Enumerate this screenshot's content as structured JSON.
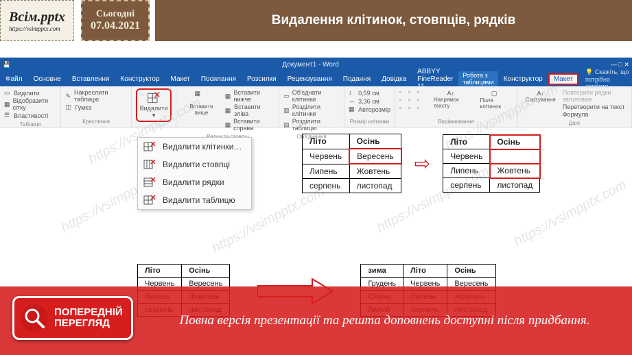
{
  "header": {
    "logo_line1": "Всім.pptx",
    "logo_line2": "https://vsimpptx.com",
    "date_label": "Сьогодні",
    "date_value": "07.04.2021",
    "slide_title": "Видалення клітинок, стовпців, рядків"
  },
  "ribbon": {
    "doc_title": "Документ1 - Word",
    "context_label": "Робота з таблицями",
    "tabs": [
      "Файл",
      "Основне",
      "Вставлення",
      "Конструктор",
      "Макет",
      "Посилання",
      "Розсилки",
      "Рецензування",
      "Подання",
      "Довідка",
      "ABBYY FineReader 11",
      "Конструктор",
      "Макет"
    ],
    "active_tab_index": 12,
    "tell_me": "Скажіть, що потрібно зробити",
    "groups": {
      "table": {
        "label": "Таблиця",
        "items": [
          "Виділити",
          "Відобразити сітку",
          "Властивості"
        ]
      },
      "draw": {
        "label": "Креслення",
        "items": [
          "Накреслити таблицю",
          "Гумка"
        ]
      },
      "delete": {
        "label": "Видалити"
      },
      "rowscols": {
        "label": "Рядки та стовпці",
        "insert_above": "Вставити вище",
        "items": [
          "Вставити нижче",
          "Вставити зліва",
          "Вставити справа"
        ]
      },
      "merge": {
        "label": "Об'єднання",
        "items": [
          "Об'єднати клітинки",
          "Розділити клітинки",
          "Розділити таблицю"
        ]
      },
      "cellsize": {
        "label": "Розмір клітинки",
        "h": "0,59 см",
        "w": "3,36 см",
        "auto": "Авторозмір"
      },
      "align": {
        "label": "Вирівнювання",
        "dir": "Напрямок тексту",
        "margins": "Поля клітинок"
      },
      "data": {
        "label": "Дані",
        "sort": "Сортування",
        "repeat": "Повторити рядки заголовків",
        "convert": "Перетворити на текст",
        "formula": "Формула"
      }
    }
  },
  "dropdown": {
    "items": [
      "Видалити клітинки…",
      "Видалити стовпці",
      "Видалити рядки",
      "Видалити таблицю"
    ]
  },
  "table_before": {
    "headers": [
      "Літо",
      "Осінь"
    ],
    "rows": [
      [
        "Червень",
        "Вересень"
      ],
      [
        "Липень",
        "Жовтень"
      ],
      [
        "серпень",
        "листопад"
      ]
    ]
  },
  "table_after_cell": {
    "headers": [
      "Літо",
      "Осінь"
    ],
    "rows": [
      [
        "Червень",
        ""
      ],
      [
        "Липень",
        "Жовтень"
      ],
      [
        "серпень",
        "листопад"
      ]
    ]
  },
  "table_lower_left": {
    "headers": [
      "Літо",
      "Осінь"
    ],
    "rows": [
      [
        "Червень",
        "Вересень"
      ],
      [
        "Липень",
        "Жовтень"
      ],
      [
        "серпень",
        "листопад"
      ]
    ]
  },
  "table_lower_right": {
    "headers": [
      "зима",
      "Літо",
      "Осінь"
    ],
    "rows": [
      [
        "Грудень",
        "Червень",
        "Вересень"
      ],
      [
        "Січень",
        "Липень",
        "Жовтень"
      ],
      [
        "Лютий",
        "серпень",
        "листопад"
      ]
    ]
  },
  "preview_badge": {
    "line1": "ПОПЕРЕДНІЙ",
    "line2": "ПЕРЕГЛЯД"
  },
  "banner_text": "Повна версія презентації та решта доповнень доступні після придбання.",
  "watermark": "https://vsimpptx.com"
}
